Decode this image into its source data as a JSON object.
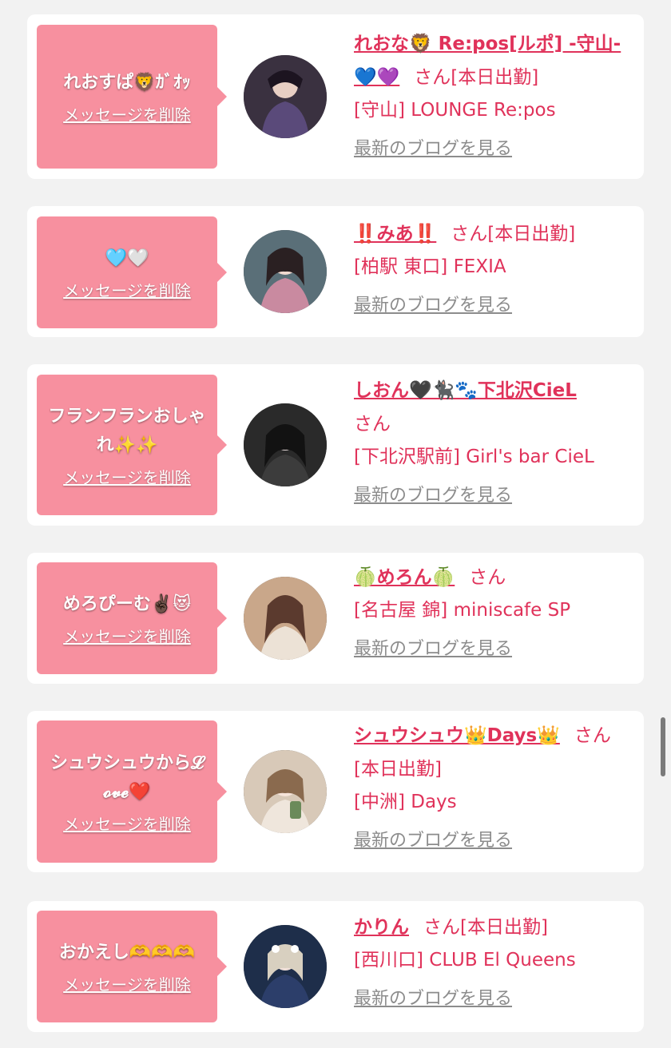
{
  "items": [
    {
      "message": "れおすぱ🦁ｶﾞｵｯ",
      "delete_label": "メッセージを削除",
      "name": "れおな🦁 Re:pos[ルポ] -守山-💙💜",
      "san": "さん",
      "status": "[本日出勤]",
      "shop": "[守山] LOUNGE Re:pos",
      "blog_label": "最新のブログを見る"
    },
    {
      "message": "🩵🤍",
      "delete_label": "メッセージを削除",
      "name": "‼️みあ‼️",
      "san": "さん",
      "status": "[本日出勤]",
      "shop": "[柏駅 東口] FEXIA",
      "blog_label": "最新のブログを見る"
    },
    {
      "message": "フランフランおしゃれ✨✨",
      "delete_label": "メッセージを削除",
      "name": "しおん🖤🐈‍⬛🐾下北沢CieL",
      "san": "さん",
      "status": "",
      "shop": "[下北沢駅前] Girl's bar CieL",
      "blog_label": "最新のブログを見る"
    },
    {
      "message": "めろぴーむ✌🏿😻",
      "delete_label": "メッセージを削除",
      "name": "🍈めろん🍈",
      "san": "さん",
      "status": "",
      "shop": "[名古屋 錦] miniscafe SP",
      "blog_label": "最新のブログを見る"
    },
    {
      "message": "シュウシュウから𝓛𝓸𝓿𝓮❤️",
      "delete_label": "メッセージを削除",
      "name": "シュウシュウ👑Days👑",
      "san": "さん",
      "status": "[本日出勤]",
      "shop": "[中洲] Days",
      "blog_label": "最新のブログを見る"
    },
    {
      "message": "おかえし🫶🫶🫶",
      "delete_label": "メッセージを削除",
      "name": "かりん",
      "san": "さん",
      "status": "[本日出勤]",
      "shop": "[西川口] CLUB El Queens",
      "blog_label": "最新のブログを見る"
    }
  ],
  "avatars": [
    {
      "icon": "avatar-photo",
      "bg": "#3a3140",
      "fg": "#6b5a8a"
    },
    {
      "icon": "avatar-photo",
      "bg": "#5a6f78",
      "fg": "#c98aa0"
    },
    {
      "icon": "avatar-photo",
      "bg": "#2a2a2a",
      "fg": "#d9cfcf"
    },
    {
      "icon": "avatar-photo",
      "bg": "#c9a78a",
      "fg": "#5b3a2e"
    },
    {
      "icon": "avatar-photo",
      "bg": "#d8c9b8",
      "fg": "#8a6a4e"
    },
    {
      "icon": "avatar-photo",
      "bg": "#1e2e4a",
      "fg": "#e6e6ee"
    }
  ],
  "colors": {
    "accent": "#e0325a",
    "bubble": "#f7909f",
    "muted": "#8c8c8c"
  }
}
